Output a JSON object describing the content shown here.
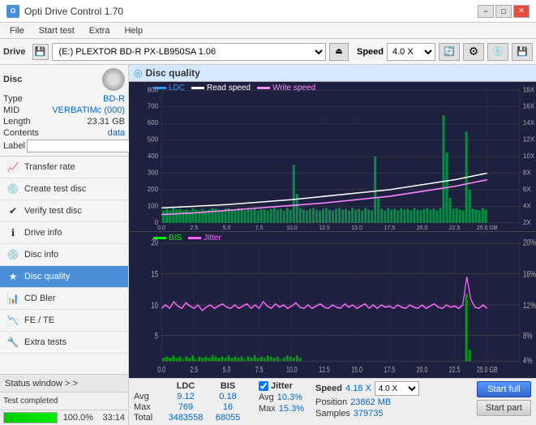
{
  "app": {
    "title": "Opti Drive Control 1.70",
    "icon": "O"
  },
  "titlebar": {
    "minimize": "−",
    "maximize": "□",
    "close": "✕"
  },
  "menu": {
    "items": [
      "File",
      "Start test",
      "Extra",
      "Help"
    ]
  },
  "toolbar": {
    "drive_label": "Drive",
    "drive_value": "(E:)  PLEXTOR BD-R  PX-LB950SA 1.06",
    "speed_label": "Speed",
    "speed_value": "4.0 X"
  },
  "disc": {
    "title": "Disc",
    "type_label": "Type",
    "type_value": "BD-R",
    "mid_label": "MID",
    "mid_value": "VERBATIMc (000)",
    "length_label": "Length",
    "length_value": "23.31 GB",
    "contents_label": "Contents",
    "contents_value": "data",
    "label_label": "Label"
  },
  "nav": {
    "items": [
      {
        "id": "transfer-rate",
        "label": "Transfer rate",
        "icon": "📈",
        "active": false
      },
      {
        "id": "create-test-disc",
        "label": "Create test disc",
        "icon": "💿",
        "active": false
      },
      {
        "id": "verify-test-disc",
        "label": "Verify test disc",
        "icon": "✔",
        "active": false
      },
      {
        "id": "drive-info",
        "label": "Drive info",
        "icon": "ℹ",
        "active": false
      },
      {
        "id": "disc-info",
        "label": "Disc info",
        "icon": "💿",
        "active": false
      },
      {
        "id": "disc-quality",
        "label": "Disc quality",
        "icon": "★",
        "active": true
      },
      {
        "id": "cd-bler",
        "label": "CD Bler",
        "icon": "📊",
        "active": false
      },
      {
        "id": "fe-te",
        "label": "FE / TE",
        "icon": "📉",
        "active": false
      },
      {
        "id": "extra-tests",
        "label": "Extra tests",
        "icon": "🔧",
        "active": false
      }
    ]
  },
  "status_window": {
    "label": "Status window  > >"
  },
  "chart": {
    "title": "Disc quality",
    "icon": "◎",
    "legend_top": [
      {
        "name": "LDC",
        "color": "#3399ff"
      },
      {
        "name": "Read speed",
        "color": "#ffffff"
      },
      {
        "name": "Write speed",
        "color": "#ff88ff"
      }
    ],
    "legend_bottom": [
      {
        "name": "BIS",
        "color": "#00ff00"
      },
      {
        "name": "Jitter",
        "color": "#ff66ff"
      }
    ],
    "top_y_labels": [
      "800",
      "700",
      "600",
      "500",
      "400",
      "300",
      "200",
      "100",
      "0"
    ],
    "top_y_right_labels": [
      "18X",
      "16X",
      "14X",
      "12X",
      "10X",
      "8X",
      "6X",
      "4X",
      "2X"
    ],
    "bottom_y_labels": [
      "20",
      "15",
      "10",
      "5"
    ],
    "bottom_y_right_labels": [
      "20%",
      "16%",
      "12%",
      "8%",
      "4%"
    ],
    "x_labels": [
      "0.0",
      "2.5",
      "5.0",
      "7.5",
      "10.0",
      "12.5",
      "15.0",
      "17.5",
      "20.0",
      "22.5",
      "25.0 GB"
    ]
  },
  "stats": {
    "avg_label": "Avg",
    "max_label": "Max",
    "total_label": "Total",
    "ldc_header": "LDC",
    "bis_header": "BIS",
    "jitter_label": "Jitter",
    "speed_label": "Speed",
    "position_label": "Position",
    "samples_label": "Samples",
    "ldc_avg": "9.12",
    "ldc_max": "769",
    "ldc_total": "3483558",
    "bis_avg": "0.18",
    "bis_max": "16",
    "bis_total": "68055",
    "jitter_avg": "10.3%",
    "jitter_max": "15.3%",
    "speed_val": "4.18 X",
    "speed_select": "4.0 X",
    "position_val": "23862 MB",
    "samples_val": "379735",
    "start_full_label": "Start full",
    "start_part_label": "Start part"
  },
  "progress": {
    "percent": "100.0%",
    "fill_width": "100%",
    "status": "Test completed",
    "time": "33:14"
  }
}
